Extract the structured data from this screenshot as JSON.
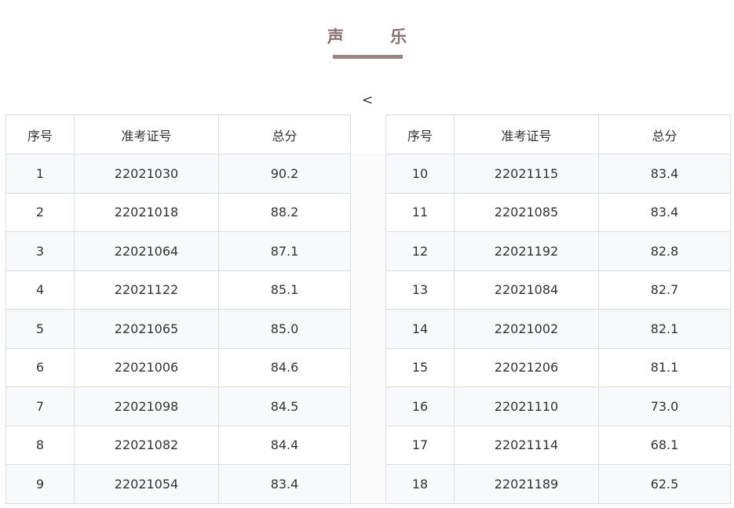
{
  "title": "声 乐",
  "nav": {
    "prev_label": "<"
  },
  "headers": {
    "index": "序号",
    "exam_id": "准考证号",
    "total": "总分"
  },
  "left_rows": [
    {
      "index": "1",
      "exam_id": "22021030",
      "total": "90.2"
    },
    {
      "index": "2",
      "exam_id": "22021018",
      "total": "88.2"
    },
    {
      "index": "3",
      "exam_id": "22021064",
      "total": "87.1"
    },
    {
      "index": "4",
      "exam_id": "22021122",
      "total": "85.1"
    },
    {
      "index": "5",
      "exam_id": "22021065",
      "total": "85.0"
    },
    {
      "index": "6",
      "exam_id": "22021006",
      "total": "84.6"
    },
    {
      "index": "7",
      "exam_id": "22021098",
      "total": "84.5"
    },
    {
      "index": "8",
      "exam_id": "22021082",
      "total": "84.4"
    },
    {
      "index": "9",
      "exam_id": "22021054",
      "total": "83.4"
    }
  ],
  "right_rows": [
    {
      "index": "10",
      "exam_id": "22021115",
      "total": "83.4"
    },
    {
      "index": "11",
      "exam_id": "22021085",
      "total": "83.4"
    },
    {
      "index": "12",
      "exam_id": "22021192",
      "total": "82.8"
    },
    {
      "index": "13",
      "exam_id": "22021084",
      "total": "82.7"
    },
    {
      "index": "14",
      "exam_id": "22021002",
      "total": "82.1"
    },
    {
      "index": "15",
      "exam_id": "22021206",
      "total": "81.1"
    },
    {
      "index": "16",
      "exam_id": "22021110",
      "total": "73.0"
    },
    {
      "index": "17",
      "exam_id": "22021114",
      "total": "68.1"
    },
    {
      "index": "18",
      "exam_id": "22021189",
      "total": "62.5"
    }
  ],
  "colors": {
    "title": "#8a7070",
    "underline": "#9a8484",
    "row_tint": "#f7f9fd",
    "border": "#dcdcdc"
  }
}
